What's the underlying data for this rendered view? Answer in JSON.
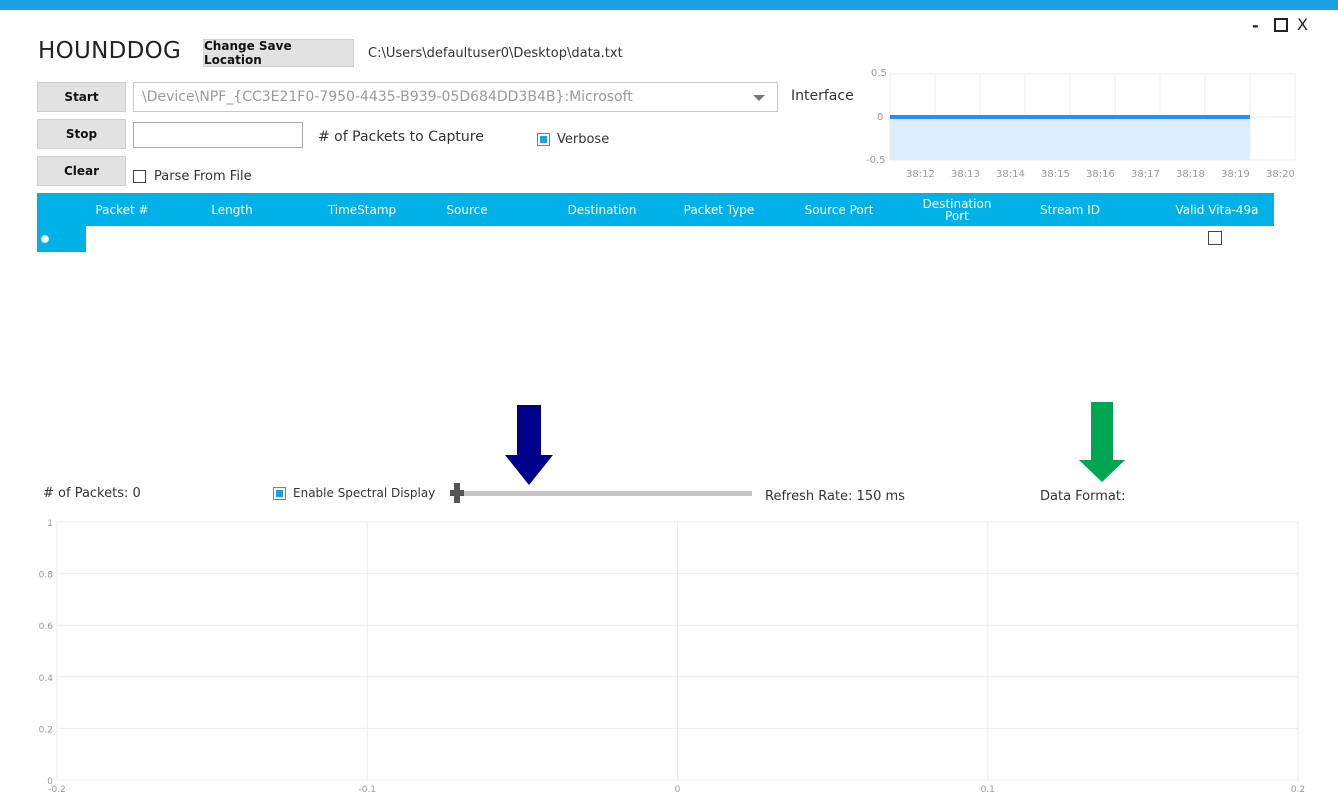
{
  "app": {
    "title": "HOUNDDOG",
    "change_save_location_label": "Change Save Location",
    "save_path": "C:\\Users\\defaultuser0\\Desktop\\data.txt"
  },
  "window_controls": {
    "minimize": "-",
    "maximize": "□",
    "close": "X"
  },
  "controls": {
    "start_label": "Start",
    "stop_label": "Stop",
    "clear_label": "Clear",
    "interface_value": "\\Device\\NPF_{CC3E21F0-7950-4435-B939-05D684DD3B4B}:Microsoft",
    "interface_label": "Interface",
    "packets_to_capture_value": "",
    "packets_to_capture_label": "# of Packets to Capture",
    "verbose_label": "Verbose",
    "verbose_checked": true,
    "parse_from_file_label": "Parse From File",
    "parse_from_file_checked": false
  },
  "table": {
    "columns": [
      "Packet #",
      "Length",
      "TimeStamp",
      "Source",
      "Destination",
      "Packet Type",
      "Source Port",
      "Destination Port",
      "Stream ID",
      "Valid Vita-49a"
    ],
    "rows": [
      {
        "valid_vita_49a": false
      }
    ]
  },
  "mini_chart": {
    "y_ticks": [
      "0.5",
      "0",
      "-0.5"
    ],
    "x_ticks": [
      "38:12",
      "38:13",
      "38:14",
      "38:15",
      "38:16",
      "38:17",
      "38:18",
      "38:19",
      "38:20"
    ],
    "line_value": 0,
    "line_color": "#1e90ff",
    "fill_color": "#dcedfb"
  },
  "spectral": {
    "packet_count_label": "# of Packets: 0",
    "enable_label": "Enable Spectral Display",
    "enable_checked": true,
    "refresh_rate_label": "Refresh Rate: 150 ms",
    "refresh_slider_level": 0,
    "data_format_label": "Data Format:"
  },
  "annotations": {
    "arrow_1_color": "#00008b",
    "arrow_2_color": "#00a651"
  },
  "chart_data": {
    "type": "line",
    "title": "",
    "xlabel": "",
    "ylabel": "",
    "xlim": [
      -0.2,
      0.2
    ],
    "ylim": [
      0,
      1
    ],
    "x_ticks": [
      "-0.2",
      "-0.1",
      "0",
      "0.1",
      "0.2"
    ],
    "y_ticks": [
      "0",
      "0.2",
      "0.4",
      "0.6",
      "0.8",
      "1"
    ],
    "series": [],
    "grid": true
  }
}
